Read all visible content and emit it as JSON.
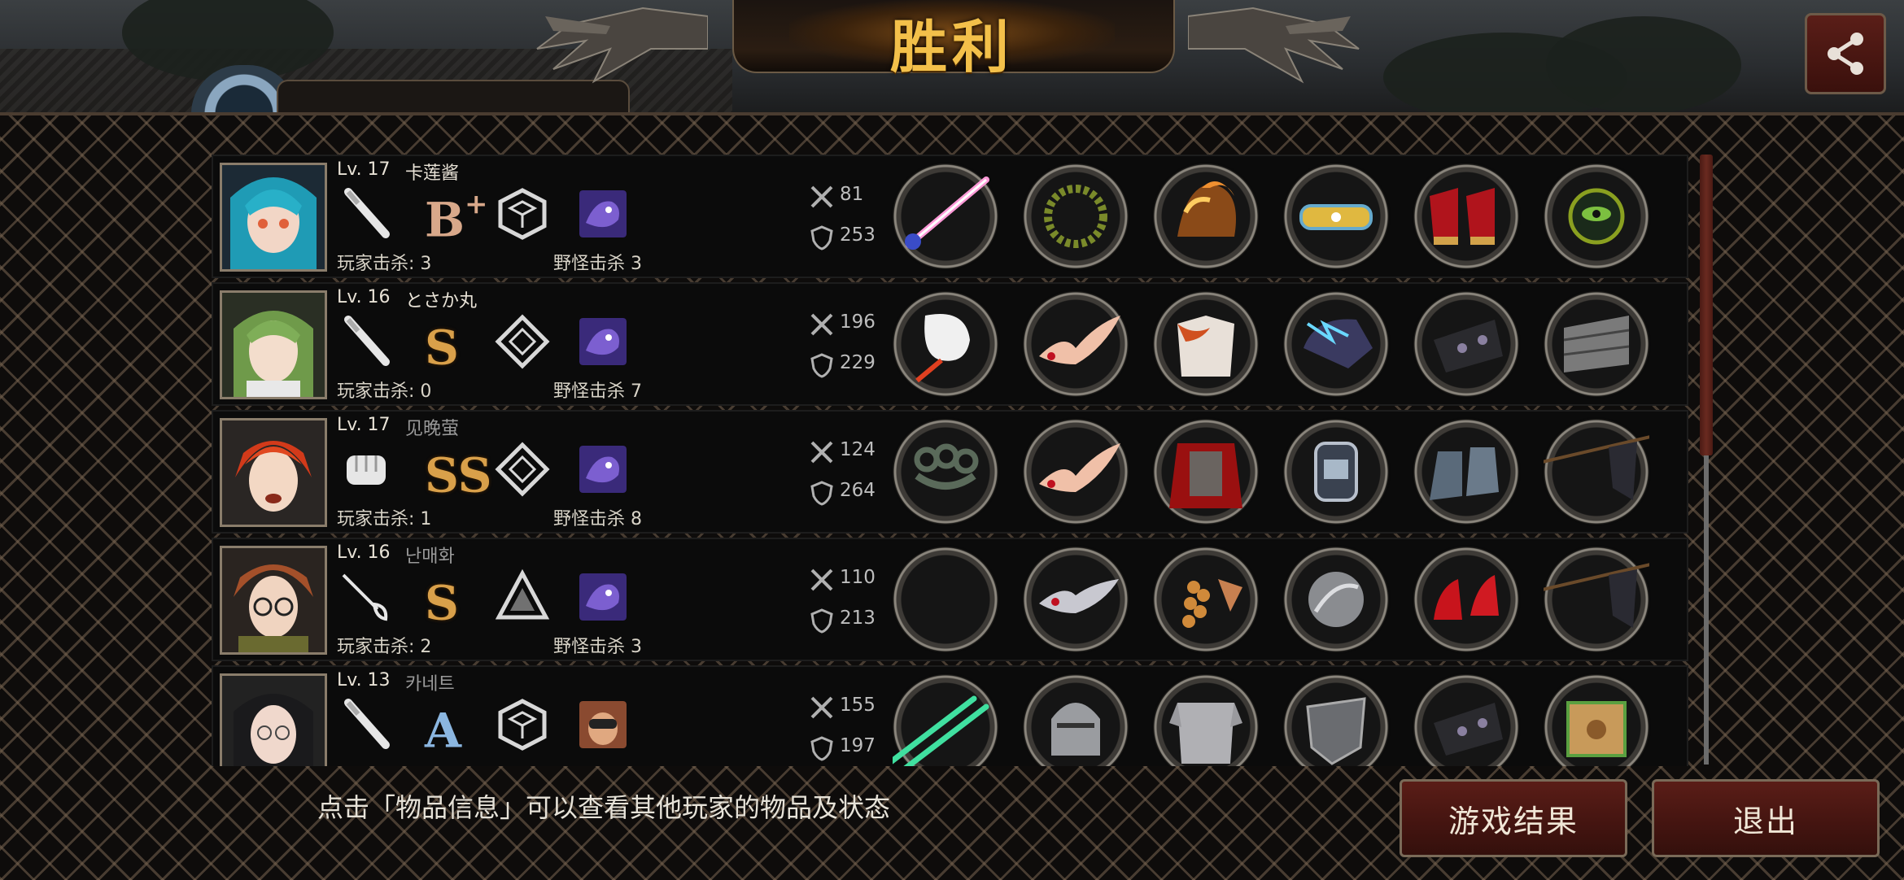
{
  "title": "胜利",
  "hint": "点击「物品信息」可以查看其他玩家的物品及状态",
  "buttons": {
    "result": "游戏结果",
    "exit": "退出"
  },
  "colors": {
    "title_gold": "#f3c04a",
    "button_red": "#4a1712",
    "frame_brown": "#7a6a58"
  },
  "players": [
    {
      "level": "Lv. 17",
      "name": "卡莲酱",
      "weapon": "baseball-bat",
      "grade": "B",
      "grade_suffix": "+",
      "rank": "hexagon-rank",
      "pet": "purple-creature",
      "player_kills": "玩家击杀: 3",
      "monster_kills": "野怪击杀 3",
      "attack": "81",
      "defense": "253",
      "items": [
        "light-saber",
        "laurel-wreath",
        "flaming-armor",
        "jeweled-headband",
        "red-platform-heels",
        "eye-of-horus-amulet"
      ]
    },
    {
      "level": "Lv. 16",
      "name": "とさか丸",
      "weapon": "baseball-bat",
      "grade": "S",
      "grade_suffix": "",
      "rank": "diamond-rank",
      "pet": "purple-creature",
      "player_kills": "玩家击杀: 0",
      "monster_kills": "野怪击杀 7",
      "attack": "196",
      "defense": "229",
      "items": [
        "swan-crane",
        "winged-tiara",
        "fur-jacket",
        "electric-helmet",
        "spiked-gauntlet",
        "steel-plate"
      ]
    },
    {
      "level": "Lv. 17",
      "name": "见晚萤",
      "weapon": "fist",
      "grade": "SS",
      "grade_suffix": "",
      "rank": "diamond-rank",
      "pet": "purple-creature",
      "player_kills": "玩家击杀: 1",
      "monster_kills": "野怪击杀 8",
      "attack": "124",
      "defense": "264",
      "items": [
        "brass-knuckles",
        "winged-tiara",
        "chainmail-cape",
        "wrist-watch",
        "steel-boots",
        "black-flag"
      ]
    },
    {
      "level": "Lv. 16",
      "name": "난매화",
      "weapon": "rapier",
      "grade": "S",
      "grade_suffix": "",
      "rank": "triangle-rank",
      "pet": "purple-creature",
      "player_kills": "玩家击杀: 2",
      "monster_kills": "野怪击杀 3",
      "attack": "110",
      "defense": "213",
      "items": [
        "empty",
        "mask-tiara",
        "grape-ornament",
        "silver-disc",
        "red-heels",
        "black-flag"
      ]
    },
    {
      "level": "Lv. 13",
      "name": "카네트",
      "weapon": "baseball-bat",
      "grade": "A",
      "grade_suffix": "",
      "rank": "hexagon-rank",
      "pet": "binocular-man",
      "player_kills": "",
      "monster_kills": "",
      "attack": "155",
      "defense": "197",
      "items": [
        "twin-light-sabers",
        "knight-helmet",
        "plate-armor",
        "kite-shield",
        "spiked-gauntlet",
        "mystery-box"
      ]
    }
  ]
}
